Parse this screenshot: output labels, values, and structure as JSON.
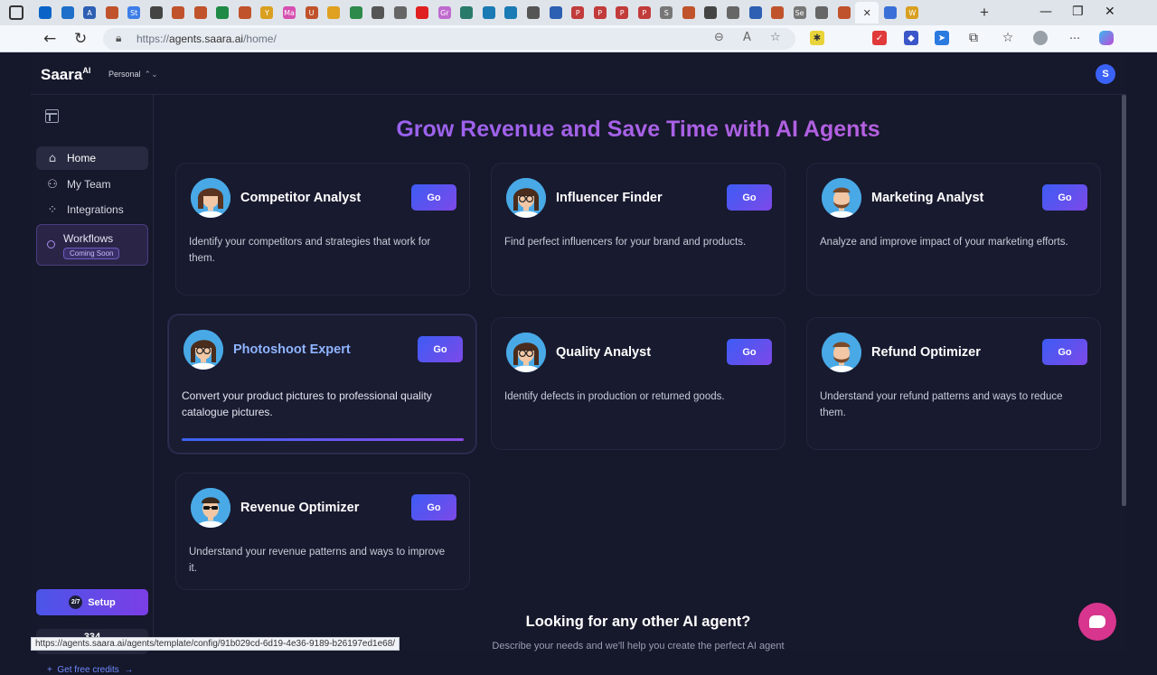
{
  "browser": {
    "url_prefix": "https://",
    "url_main": "agents.saara.ai",
    "url_path": "/home/",
    "status_url": "https://agents.saara.ai/agents/template/config/91b029cd-6d19-4e36-9189-b26197ed1e68/",
    "tab_favicons": [
      {
        "icon": "outlook-icon",
        "color": "#0a64c8",
        "label": ""
      },
      {
        "icon": "onedrive-icon",
        "color": "#1d6fc9",
        "label": ""
      },
      {
        "icon": "app-icon",
        "color": "#2d5fb3",
        "label": "A"
      },
      {
        "icon": "scissors-icon",
        "color": "#c0532b",
        "label": ""
      },
      {
        "icon": "app-icon",
        "color": "#3d7ee8",
        "label": "St"
      },
      {
        "icon": "list-icon",
        "color": "#444",
        "label": ""
      },
      {
        "icon": "app-icon",
        "color": "#c0532b",
        "label": ""
      },
      {
        "icon": "scissors-icon",
        "color": "#c0532b",
        "label": ""
      },
      {
        "icon": "sheet-icon",
        "color": "#1f8a45",
        "label": ""
      },
      {
        "icon": "app-icon",
        "color": "#c0532b",
        "label": ""
      },
      {
        "icon": "app-icon",
        "color": "#d9a020",
        "label": "Y"
      },
      {
        "icon": "app-icon",
        "color": "#d64fb0",
        "label": "Ma"
      },
      {
        "icon": "app-icon",
        "color": "#c0532b",
        "label": "U"
      },
      {
        "icon": "chart-icon",
        "color": "#e0a020",
        "label": ""
      },
      {
        "icon": "app-icon",
        "color": "#2d8a4a",
        "label": ""
      },
      {
        "icon": "app-icon",
        "color": "#555",
        "label": ""
      },
      {
        "icon": "app-icon",
        "color": "#666",
        "label": ""
      },
      {
        "icon": "youtube-icon",
        "color": "#e02020",
        "label": ""
      },
      {
        "icon": "app-icon",
        "color": "#c06ad0",
        "label": "Gr"
      },
      {
        "icon": "app-icon",
        "color": "#2a7a6a",
        "label": ""
      },
      {
        "icon": "app-icon",
        "color": "#1a7ab3",
        "label": ""
      },
      {
        "icon": "app-icon",
        "color": "#1a7ab3",
        "label": ""
      },
      {
        "icon": "image-icon",
        "color": "#555",
        "label": ""
      },
      {
        "icon": "app-icon",
        "color": "#2d5fb3",
        "label": ""
      },
      {
        "icon": "pinterest-icon",
        "color": "#c23b3b",
        "label": "P"
      },
      {
        "icon": "pinterest-icon",
        "color": "#c23b3b",
        "label": "P"
      },
      {
        "icon": "pinterest-icon",
        "color": "#c23b3b",
        "label": "P"
      },
      {
        "icon": "pinterest-icon",
        "color": "#c23b3b",
        "label": "P"
      },
      {
        "icon": "app-icon",
        "color": "#777",
        "label": "S"
      },
      {
        "icon": "app-icon",
        "color": "#c0532b",
        "label": ""
      },
      {
        "icon": "app-icon",
        "color": "#444",
        "label": ""
      },
      {
        "icon": "globe-icon",
        "color": "#666",
        "label": ""
      },
      {
        "icon": "app-icon",
        "color": "#2d5fb3",
        "label": ""
      },
      {
        "icon": "scissors-icon",
        "color": "#c0532b",
        "label": ""
      },
      {
        "icon": "app-icon",
        "color": "#777",
        "label": "Se"
      },
      {
        "icon": "globe-icon",
        "color": "#666",
        "label": ""
      },
      {
        "icon": "scissors-icon",
        "color": "#c0532b",
        "label": ""
      }
    ],
    "active_tab_close": "✕",
    "tabs_after": [
      {
        "icon": "search-icon",
        "color": "#3a6fd8",
        "label": ""
      },
      {
        "icon": "app-icon",
        "color": "#d9a020",
        "label": "W"
      }
    ]
  },
  "app": {
    "brand": "Saara",
    "brand_sup": "AI",
    "workspace": "Personal",
    "user_initial": "S",
    "sidebar": {
      "items": [
        {
          "label": "Home",
          "icon": "home-icon"
        },
        {
          "label": "My Team",
          "icon": "team-icon"
        },
        {
          "label": "Integrations",
          "icon": "integrations-icon"
        }
      ],
      "workflows_label": "Workflows",
      "workflows_badge": "Coming Soon",
      "setup_progress": "2/7",
      "setup_label": "Setup",
      "credits_value": "334",
      "credits_label": "credits",
      "free_credits": "Get free credits"
    },
    "heading": "Grow Revenue and Save Time with AI Agents",
    "go_label": "Go",
    "agents": [
      {
        "name": "Competitor Analyst",
        "desc": "Identify your competitors and strategies that work for them.",
        "avatar": "woman-avatar-icon"
      },
      {
        "name": "Influencer Finder",
        "desc": "Find perfect influencers for your brand and products.",
        "avatar": "woman-glasses-avatar-icon"
      },
      {
        "name": "Marketing Analyst",
        "desc": "Analyze and improve impact of your marketing efforts.",
        "avatar": "bearded-man-avatar-icon"
      },
      {
        "name": "Photoshoot Expert",
        "desc": "Convert your product pictures to professional quality catalogue pictures.",
        "avatar": "woman-glasses-avatar-icon"
      },
      {
        "name": "Quality Analyst",
        "desc": "Identify defects in production or returned goods.",
        "avatar": "woman-glasses-avatar-icon"
      },
      {
        "name": "Refund Optimizer",
        "desc": "Understand your refund patterns and ways to reduce them.",
        "avatar": "bearded-man-avatar-icon"
      },
      {
        "name": "Revenue Optimizer",
        "desc": "Understand your revenue patterns and ways to improve it.",
        "avatar": "sunglasses-man-avatar-icon"
      }
    ],
    "photoshoot_progress": 1.0,
    "looking_title": "Looking for any other AI agent?",
    "looking_sub": "Describe your needs and we'll help you create the perfect AI agent"
  }
}
